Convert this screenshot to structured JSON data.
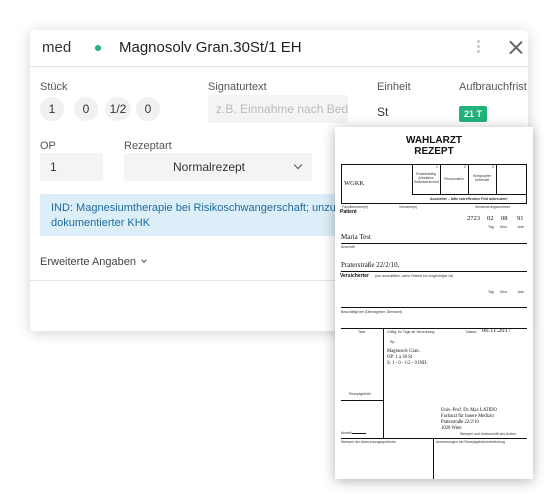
{
  "app_label": "med",
  "drug_title": "Magnosolv Gran.30St/1 EH",
  "labels": {
    "stueck": "Stück",
    "signaturtext": "Signaturtext",
    "einheit": "Einheit",
    "aufbrauchfrist": "Aufbrauchfrist",
    "op": "OP",
    "rezeptart": "Rezeptart"
  },
  "dose_buttons": [
    "1",
    "0",
    "1/2",
    "0"
  ],
  "signatur_placeholder": "z.B. Einnahme nach Bedarf",
  "einheit_value": "St",
  "aufbrauchfrist_badge": "21 T",
  "op_value": "1",
  "rezeptart_value": "Normalrezept",
  "indication_text": "IND: Magnesiumtherapie bei Risikoschwangerschaft; unzureichende Wirkung bei dokumentierter KHK",
  "advanced_label": "Erweiterte Angaben",
  "colors": {
    "accent_green": "#21b37a",
    "info_bg": "#dceef8",
    "info_text": "#1e6c9c"
  },
  "icons": [
    "status-dot",
    "more-vertical-icon",
    "close-icon",
    "chevron-down-icon"
  ],
  "prescription": {
    "title_line1": "WAHLARZT",
    "title_line2": "REZEPT",
    "col_numbers": [
      "1",
      "2",
      "3"
    ],
    "col_labels": [
      "Erwerbstätig Arbeitslos Selbstversichert",
      "Pensionist/in",
      "Kriegsopfer Unterhalt"
    ],
    "insurer": "WGKK",
    "fill_note": "Aussteller – bitte zutreffendes Feld ankreuzen!",
    "header_labels": [
      "Familienname(n)",
      "Vorname(n)",
      "Versicherungsnummer"
    ],
    "patient_label": "Patient",
    "svnr": "2723",
    "birth_day": "02",
    "birth_month": "08",
    "birth_year": "91",
    "tag_label": "Tag",
    "mon_label": "Mon.",
    "jahr_label": "Jahr",
    "patient_name": "Maria Test",
    "anschrift_label": "Anschrift",
    "patient_address": "Praterstraße 22/2/10,",
    "versicherter_label": "Versicherter",
    "versicherter_note": "(nur auszufüllen, wenn Patient ein Angehöriger ist)",
    "employer_label": "Beschäftigt bei (Dienstgeber, Dienstort)",
    "taxe_label": "Taxe",
    "validity_text": "Gültig: f/o Tage ab Verordnung",
    "datum_label": "Datum:",
    "date": "06.11.2017",
    "rp": "Rp.",
    "drug_line1": "Magnosolv Gran.",
    "drug_line2": "OP: 1 a 30 St",
    "drug_line3": "S: 1 - 0 - 1/2 - 0 IND:",
    "rezeptgebuehr_label": "Rezeptgebühr",
    "anzahl_label": "Anzahl",
    "doctor_line1": "Univ.-Prof. Dr. Max LATIDO",
    "doctor_line2": "Facharzt für Innere Medizin",
    "doctor_line3": "Praterstraße 22/2/10",
    "doctor_line4": "1020 Wien",
    "stamp_label": "Stempel und Unterschrift des Arztes",
    "pharmacy_stamp_label": "Stempel der Abrechnungsapotheke",
    "fee_note_label": "Anmerkungen bei Rezeptgebührenbefreiung"
  }
}
